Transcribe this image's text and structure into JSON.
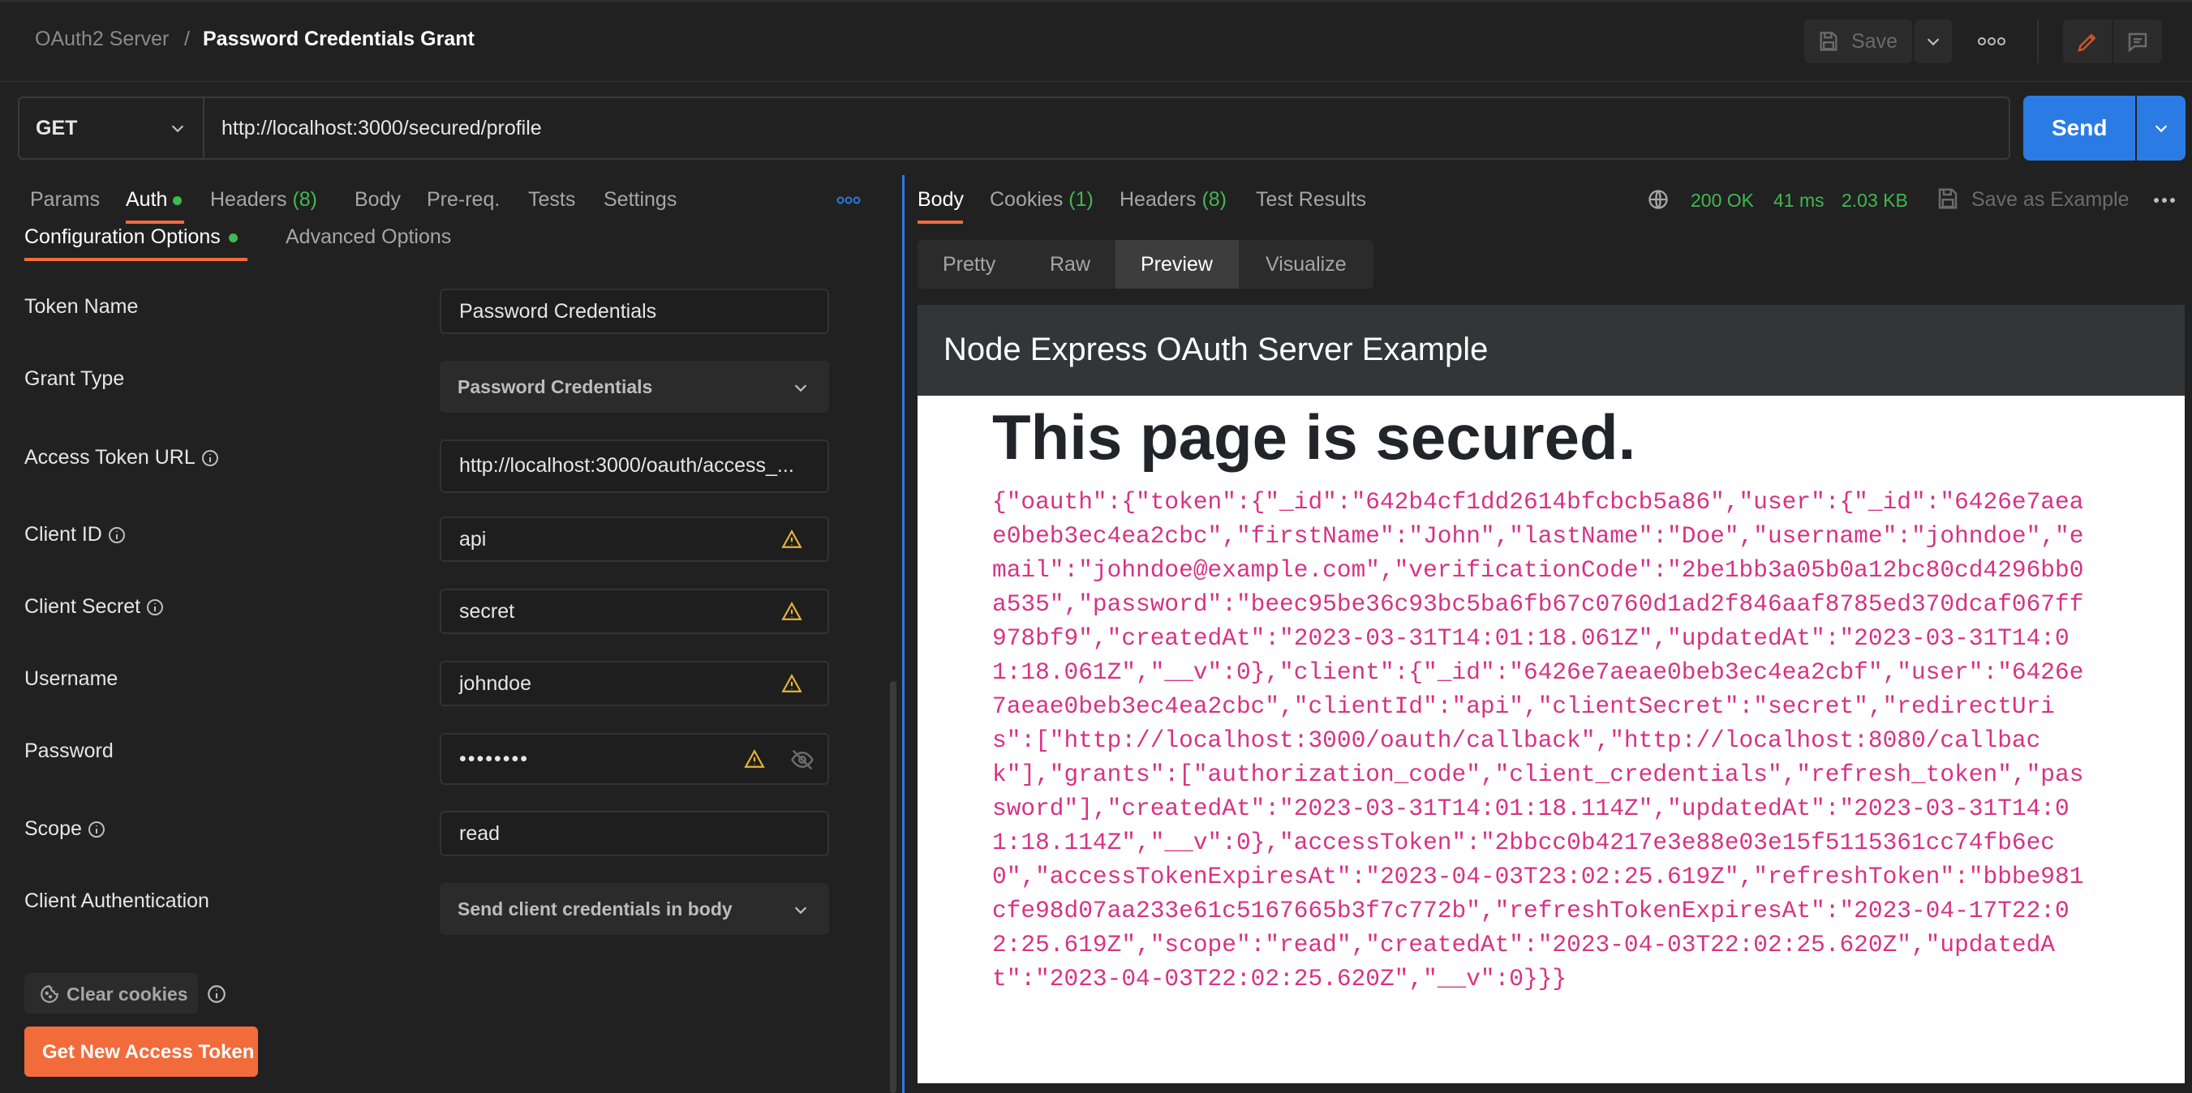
{
  "header": {
    "breadcrumb_parent": "OAuth2 Server",
    "breadcrumb_separator": "/",
    "breadcrumb_current": "Password Credentials Grant",
    "save_label": "Save"
  },
  "request": {
    "method": "GET",
    "url": "http://localhost:3000/secured/profile",
    "send_label": "Send"
  },
  "request_tabs": {
    "params": "Params",
    "auth": "Auth",
    "headers": "Headers",
    "headers_count": "(8)",
    "body": "Body",
    "prereq": "Pre-req.",
    "tests": "Tests",
    "settings": "Settings"
  },
  "auth_subtabs": {
    "config": "Configuration Options",
    "advanced": "Advanced Options"
  },
  "auth_fields": {
    "token_name": {
      "label": "Token Name",
      "value": "Password Credentials"
    },
    "grant_type": {
      "label": "Grant Type",
      "value": "Password Credentials"
    },
    "access_token_url": {
      "label": "Access Token URL",
      "value": "http://localhost:3000/oauth/access_..."
    },
    "client_id": {
      "label": "Client ID",
      "value": "api"
    },
    "client_secret": {
      "label": "Client Secret",
      "value": "secret"
    },
    "username": {
      "label": "Username",
      "value": "johndoe"
    },
    "password": {
      "label": "Password",
      "value": "••••••••"
    },
    "scope": {
      "label": "Scope",
      "value": "read"
    },
    "client_auth": {
      "label": "Client Authentication",
      "value": "Send client credentials in body"
    }
  },
  "actions": {
    "clear_cookies": "Clear cookies",
    "get_token": "Get New Access Token"
  },
  "response_tabs": {
    "body": "Body",
    "cookies": "Cookies",
    "cookies_count": "(1)",
    "headers": "Headers",
    "headers_count": "(8)",
    "test_results": "Test Results"
  },
  "response_meta": {
    "status": "200 OK",
    "time": "41 ms",
    "size": "2.03 KB",
    "save_example": "Save as Example"
  },
  "view_modes": {
    "pretty": "Pretty",
    "raw": "Raw",
    "preview": "Preview",
    "visualize": "Visualize"
  },
  "preview": {
    "header_title": "Node Express OAuth Server Example",
    "heading": "This page is secured.",
    "json": "{\"oauth\":{\"token\":{\"_id\":\"642b4cf1dd2614bfcbcb5a86\",\"user\":{\"_id\":\"6426e7aeae0beb3ec4ea2cbc\",\"firstName\":\"John\",\"lastName\":\"Doe\",\"username\":\"johndoe\",\"email\":\"johndoe@example.com\",\"verificationCode\":\"2be1bb3a05b0a12bc80cd4296bb0a535\",\"password\":\"beec95be36c93bc5ba6fb67c0760d1ad2f846aaf8785ed370dcaf067ff978bf9\",\"createdAt\":\"2023-03-31T14:01:18.061Z\",\"updatedAt\":\"2023-03-31T14:01:18.061Z\",\"__v\":0},\"client\":{\"_id\":\"6426e7aeae0beb3ec4ea2cbf\",\"user\":\"6426e7aeae0beb3ec4ea2cbc\",\"clientId\":\"api\",\"clientSecret\":\"secret\",\"redirectUris\":[\"http://localhost:3000/oauth/callback\",\"http://localhost:8080/callback\"],\"grants\":[\"authorization_code\",\"client_credentials\",\"refresh_token\",\"password\"],\"createdAt\":\"2023-03-31T14:01:18.114Z\",\"updatedAt\":\"2023-03-31T14:01:18.114Z\",\"__v\":0},\"accessToken\":\"2bbcc0b4217e3e88e03e15f5115361cc74fb6ec0\",\"accessTokenExpiresAt\":\"2023-04-03T23:02:25.619Z\",\"refreshToken\":\"bbbe981cfe98d07aa233e61c5167665b3f7c772b\",\"refreshTokenExpiresAt\":\"2023-04-17T22:02:25.619Z\",\"scope\":\"read\",\"createdAt\":\"2023-04-03T22:02:25.620Z\",\"updatedAt\":\"2023-04-03T22:02:25.620Z\",\"__v\":0}}}"
  },
  "colors": {
    "accent_orange": "#f26b3a",
    "send_blue": "#2b7be4",
    "status_green": "#3fb950",
    "warning_yellow": "#e8b339",
    "code_pink": "#d63384"
  }
}
